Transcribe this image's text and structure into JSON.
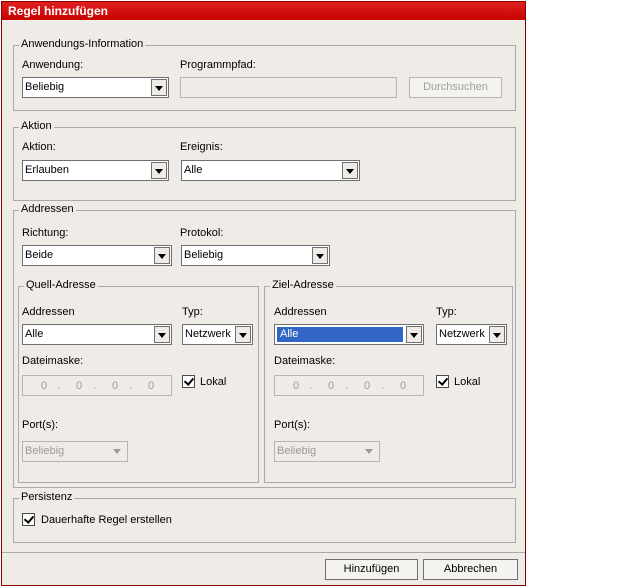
{
  "dialog": {
    "title": "Regel hinzufügen"
  },
  "app_info": {
    "legend": "Anwendungs-Information",
    "application_label": "Anwendung:",
    "application_value": "Beliebig",
    "path_label": "Programmpfad:",
    "path_value": "",
    "browse_label": "Durchsuchen"
  },
  "action": {
    "legend": "Aktion",
    "action_label": "Aktion:",
    "action_value": "Erlauben",
    "event_label": "Ereignis:",
    "event_value": "Alle"
  },
  "addresses": {
    "legend": "Addressen",
    "direction_label": "Richtung:",
    "direction_value": "Beide",
    "protocol_label": "Protokol:",
    "protocol_value": "Beliebig",
    "source": {
      "legend": "Quell-Adresse",
      "addresses_label": "Addressen",
      "addresses_value": "Alle",
      "type_label": "Typ:",
      "type_value": "Netzwerk",
      "mask_label": "Dateimaske:",
      "ip_octets": [
        "0",
        "0",
        "0",
        "0"
      ],
      "local_label": "Lokal",
      "local_checked": true,
      "ports_label": "Port(s):",
      "ports_value": "Beliebig"
    },
    "target": {
      "legend": "Ziel-Adresse",
      "addresses_label": "Addressen",
      "addresses_value": "Alle",
      "type_label": "Typ:",
      "type_value": "Netzwerk",
      "mask_label": "Dateimaske:",
      "ip_octets": [
        "0",
        "0",
        "0",
        "0"
      ],
      "local_label": "Lokal",
      "local_checked": true,
      "ports_label": "Port(s):",
      "ports_value": "Beliebig"
    }
  },
  "persistence": {
    "legend": "Persistenz",
    "permanent_label": "Dauerhafte Regel erstellen",
    "permanent_checked": true
  },
  "footer": {
    "add_label": "Hinzufügen",
    "cancel_label": "Abbrechen"
  },
  "colors": {
    "titlebar": "#c80000",
    "selection": "#3166c5",
    "dialog_bg": "#efebe7"
  }
}
